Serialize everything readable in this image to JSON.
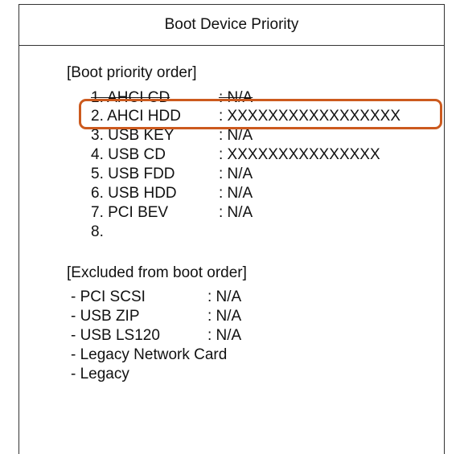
{
  "header": {
    "title": "Boot Device Priority"
  },
  "boot_priority": {
    "heading": "[Boot priority order]",
    "items": [
      {
        "name": "1. AHCI CD",
        "value": ": N/A"
      },
      {
        "name": "2. AHCI HDD",
        "value": ": XXXXXXXXXXXXXXXXX"
      },
      {
        "name": "3. USB KEY",
        "value": ": N/A"
      },
      {
        "name": "4. USB CD",
        "value": ": XXXXXXXXXXXXXXX"
      },
      {
        "name": "5. USB FDD",
        "value": ": N/A"
      },
      {
        "name": "6. USB HDD",
        "value": ": N/A"
      },
      {
        "name": "7. PCI BEV",
        "value": ": N/A"
      },
      {
        "name": "8.",
        "value": ""
      }
    ]
  },
  "excluded": {
    "heading": "[Excluded from boot order]",
    "items": [
      {
        "name": "- PCI SCSI",
        "value": ": N/A"
      },
      {
        "name": "- USB ZIP",
        "value": ": N/A"
      },
      {
        "name": "- USB LS120",
        "value": ": N/A"
      },
      {
        "name": "- Legacy Network Card",
        "value": ""
      },
      {
        "name": "- Legacy",
        "value": ""
      }
    ]
  },
  "highlight_color": "#cc5a1e"
}
